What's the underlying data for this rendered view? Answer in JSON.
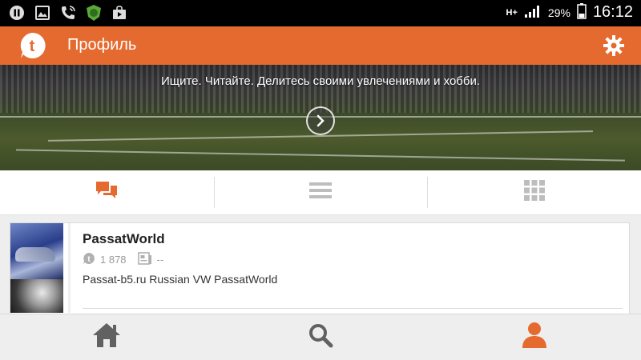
{
  "status_bar": {
    "network": "H+",
    "battery": "29%",
    "time": "16:12"
  },
  "app_bar": {
    "title": "Профиль"
  },
  "banner": {
    "tagline": "Ищите. Читайте. Делитесь своими увлечениями и хобби."
  },
  "tabs": [
    {
      "name": "chat",
      "icon": "chat-bubbles-icon",
      "active": true
    },
    {
      "name": "list",
      "icon": "list-icon",
      "active": false
    },
    {
      "name": "grid",
      "icon": "grid-icon",
      "active": false
    }
  ],
  "card": {
    "title": "PassatWorld",
    "members": "1 878",
    "topics": "--",
    "description": "Passat-b5.ru Russian VW PassatWorld"
  },
  "bottom_nav": [
    {
      "name": "home",
      "icon": "home-icon",
      "active": false
    },
    {
      "name": "search",
      "icon": "search-icon",
      "active": false
    },
    {
      "name": "profile",
      "icon": "profile-icon",
      "active": true
    }
  ],
  "colors": {
    "accent": "#e56a2f",
    "inactive_icon": "#616161",
    "tab_inactive": "#bdbdbd"
  }
}
